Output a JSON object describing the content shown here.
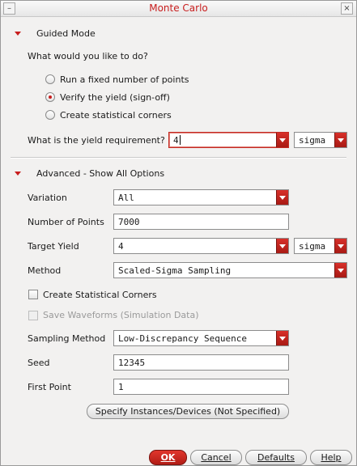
{
  "window": {
    "title": "Monte Carlo"
  },
  "guided": {
    "section_label": "Guided Mode",
    "question": "What would you like to do?",
    "options": [
      {
        "label": "Run a fixed number of points",
        "selected": false
      },
      {
        "label": "Verify the yield (sign-off)",
        "selected": true
      },
      {
        "label": "Create statistical corners",
        "selected": false
      }
    ],
    "yield_requirement_label": "What is the yield requirement?",
    "yield_requirement_value": "4",
    "yield_unit": "sigma"
  },
  "advanced": {
    "section_label": "Advanced - Show All Options",
    "variation_label": "Variation",
    "variation_value": "All",
    "points_label": "Number of Points",
    "points_value": "7000",
    "target_yield_label": "Target Yield",
    "target_yield_value": "4",
    "target_yield_unit": "sigma",
    "method_label": "Method",
    "method_value": "Scaled-Sigma Sampling",
    "create_corners_label": "Create Statistical Corners",
    "create_corners_checked": false,
    "save_waveforms_label": "Save Waveforms (Simulation Data)",
    "save_waveforms_checked": false,
    "sampling_method_label": "Sampling Method",
    "sampling_method_value": "Low-Discrepancy Sequence",
    "seed_label": "Seed",
    "seed_value": "12345",
    "first_point_label": "First Point",
    "first_point_value": "1",
    "specify_button_label": "Specify Instances/Devices (Not Specified)"
  },
  "buttons": {
    "ok": "OK",
    "cancel": "Cancel",
    "defaults": "Defaults",
    "help": "Help"
  },
  "colors": {
    "accent": "#c81e1e"
  }
}
